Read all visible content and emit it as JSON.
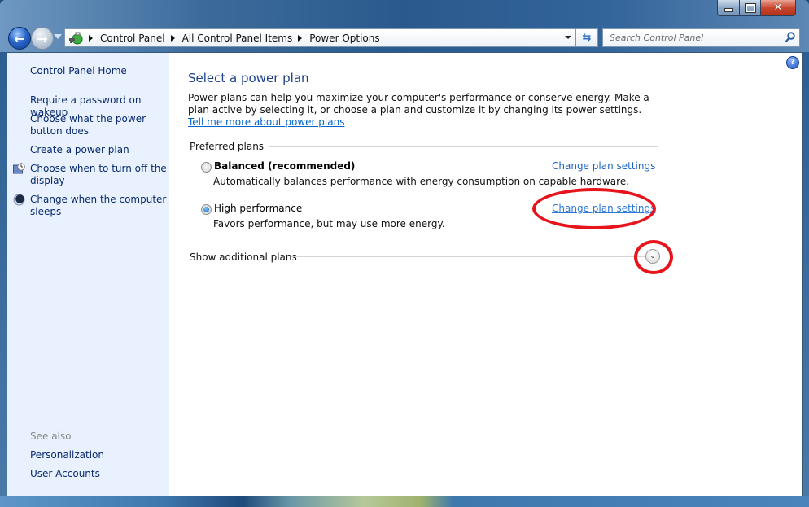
{
  "window": {
    "controls": {
      "minimize": "minimize",
      "maximize": "maximize",
      "close": "✕"
    }
  },
  "nav": {
    "back_icon": "←",
    "forward_icon": "→"
  },
  "address_bar": {
    "breadcrumbs": [
      "Control Panel",
      "All Control Panel Items",
      "Power Options"
    ]
  },
  "refresh_icon": "⇆",
  "search": {
    "placeholder": "Search Control Panel",
    "value": ""
  },
  "help_icon": "?",
  "sidebar": {
    "home": "Control Panel Home",
    "items": [
      {
        "label": "Require a password on wakeup",
        "icon": null
      },
      {
        "label": "Choose what the power button does",
        "icon": null
      },
      {
        "label": "Create a power plan",
        "icon": null
      },
      {
        "label": "Choose when to turn off the display",
        "icon": "display-clock-icon"
      },
      {
        "label": "Change when the computer sleeps",
        "icon": "moon-icon"
      }
    ],
    "see_also": {
      "heading": "See also",
      "links": [
        "Personalization",
        "User Accounts"
      ]
    }
  },
  "main": {
    "title": "Select a power plan",
    "description": "Power plans can help you maximize your computer's performance or conserve energy. Make a plan active by selecting it, or choose a plan and customize it by changing its power settings. ",
    "description_link": "Tell me more about power plans",
    "preferred_heading": "Preferred plans",
    "plans": [
      {
        "name": "Balanced (recommended)",
        "description": "Automatically balances performance with energy consumption on capable hardware.",
        "selected": false,
        "link": "Change plan settings"
      },
      {
        "name": "High performance",
        "description": "Favors performance, but may use more energy.",
        "selected": true,
        "link": "Change plan settings"
      }
    ],
    "show_additional": "Show additional plans",
    "expand_icon": "⌄"
  },
  "annotations": {
    "highlight_color": "#e8141c"
  }
}
